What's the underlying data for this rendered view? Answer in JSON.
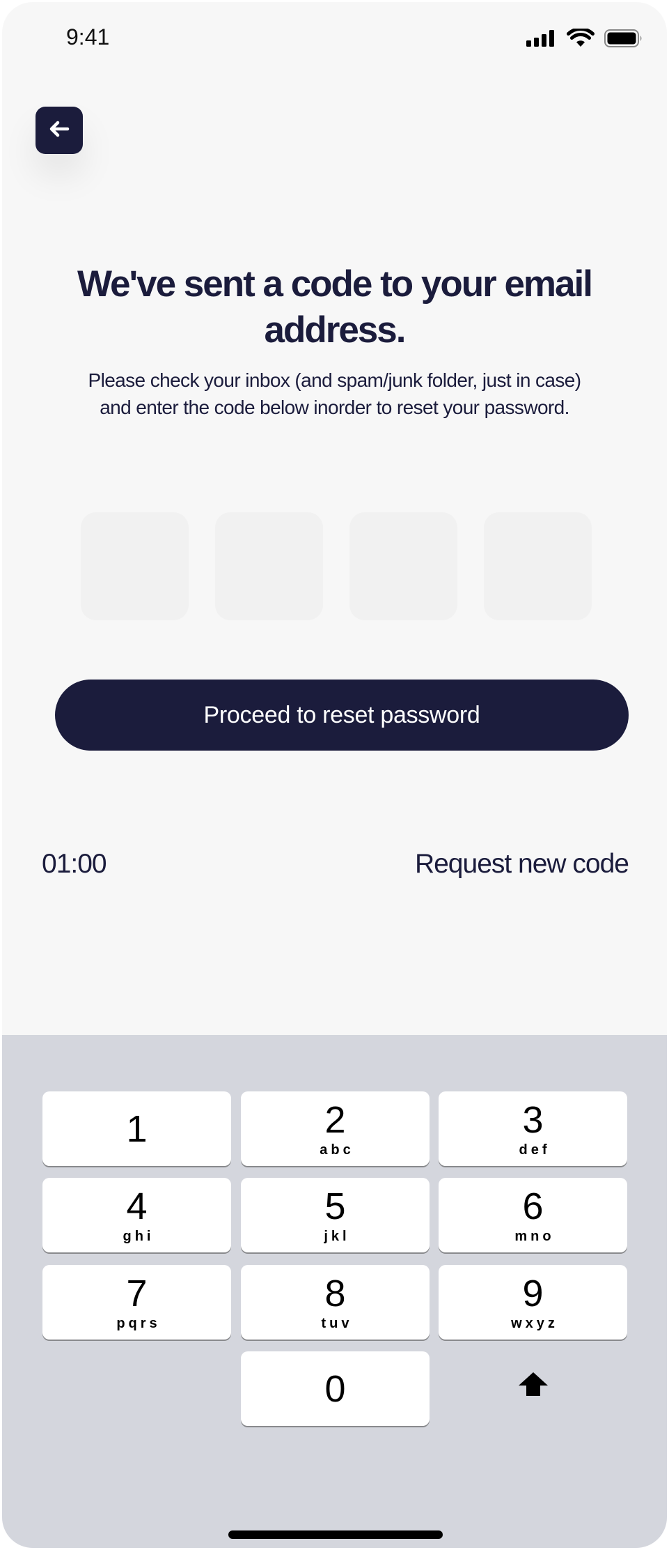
{
  "status_bar": {
    "time": "9:41",
    "icons": [
      "signal-icon",
      "wifi-icon",
      "battery-icon"
    ]
  },
  "header": {
    "back_icon": "arrow-left-icon",
    "title": "We've sent a  code to your email address.",
    "subtitle": "Please check your inbox (and spam/junk folder, just in case) and enter the code below inorder to reset your password."
  },
  "code_input": {
    "digits": [
      "",
      "",
      "",
      ""
    ]
  },
  "actions": {
    "proceed_label": "Proceed to reset password",
    "timer": "01:00",
    "request_label": "Request new code"
  },
  "keypad": {
    "keys": [
      {
        "digit": "1",
        "letters": ""
      },
      {
        "digit": "2",
        "letters": "abc"
      },
      {
        "digit": "3",
        "letters": "def"
      },
      {
        "digit": "4",
        "letters": "ghi"
      },
      {
        "digit": "5",
        "letters": "jkl"
      },
      {
        "digit": "6",
        "letters": "mno"
      },
      {
        "digit": "7",
        "letters": "pqrs"
      },
      {
        "digit": "8",
        "letters": "tuv"
      },
      {
        "digit": "9",
        "letters": "wxyz"
      },
      {
        "digit": "0",
        "letters": ""
      }
    ],
    "delete_icon": "backspace-arrow-icon"
  },
  "colors": {
    "primary": "#1b1c3c",
    "background": "#f7f7f7",
    "keyboard": "#d4d6dd"
  }
}
